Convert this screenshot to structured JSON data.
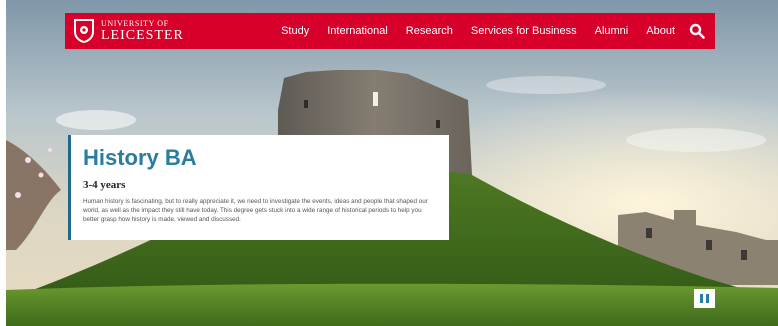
{
  "brand": {
    "line1": "UNIVERSITY OF",
    "line2": "LEICESTER",
    "color": "#d6002a"
  },
  "nav": {
    "items": [
      {
        "label": "Study"
      },
      {
        "label": "International"
      },
      {
        "label": "Research"
      },
      {
        "label": "Services for Business"
      },
      {
        "label": "Alumni"
      },
      {
        "label": "About"
      }
    ],
    "search_icon": "search-icon"
  },
  "hero": {
    "title": "History BA",
    "duration": "3-4 years",
    "description": "Human history is fascinating, but to really appreciate it, we need to investigate the events, ideas and people that shaped our world, as well as the impact they still have today. This degree gets stuck into a wide range of historical periods to help you better grasp how history is made, viewed and discussed.",
    "accent_color": "#2a7ca1"
  },
  "controls": {
    "pause_icon": "pause-icon"
  }
}
